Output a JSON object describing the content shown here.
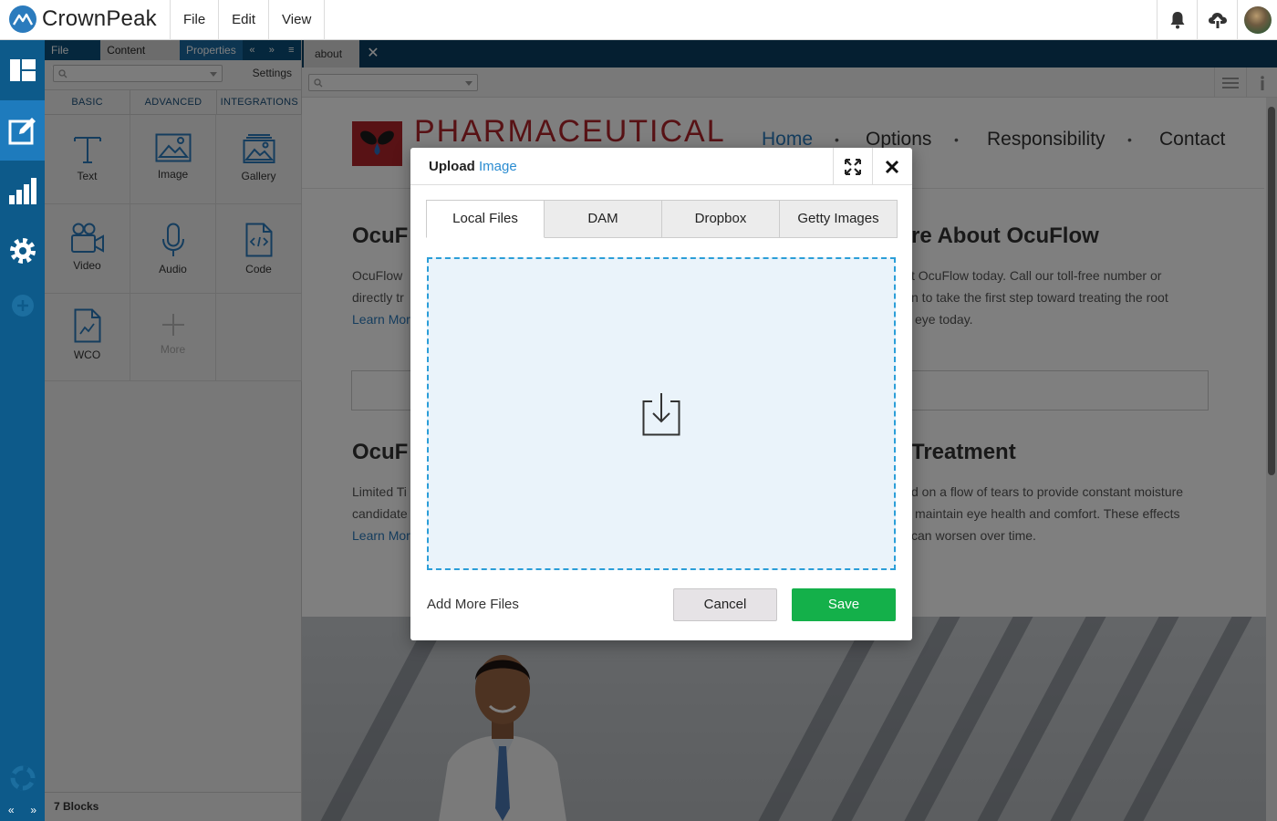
{
  "app": {
    "brand": "CrownPeak",
    "menu": [
      "File",
      "Edit",
      "View"
    ],
    "top_icons": [
      "bell-icon",
      "cloud-upload-icon",
      "user-avatar"
    ]
  },
  "rail": {
    "items": [
      "dashboard-icon",
      "edit-icon",
      "analytics-icon",
      "settings-icon",
      "add-icon",
      "help-icon"
    ],
    "active": "edit-icon",
    "bottom": [
      "«",
      "»"
    ]
  },
  "panel": {
    "tabs": [
      "File View",
      "Content Block",
      "Properties"
    ],
    "active_tab": "Content Block",
    "controls": [
      "«",
      "»",
      "≡"
    ],
    "search_placeholder": "",
    "settings_label": "Settings",
    "categories": [
      "BASIC",
      "ADVANCED",
      "INTEGRATIONS"
    ],
    "blocks": [
      {
        "label": "Text",
        "icon": "text-icon"
      },
      {
        "label": "Image",
        "icon": "image-icon"
      },
      {
        "label": "Gallery",
        "icon": "gallery-icon"
      },
      {
        "label": "Video",
        "icon": "video-icon"
      },
      {
        "label": "Audio",
        "icon": "microphone-icon"
      },
      {
        "label": "Code",
        "icon": "code-file-icon"
      },
      {
        "label": "WCO",
        "icon": "wco-file-icon"
      },
      {
        "label": "More",
        "icon": "plus-icon"
      }
    ],
    "footer": "7 Blocks"
  },
  "document": {
    "tab_label": "about",
    "close_label": "✕"
  },
  "site": {
    "title": "PHARMACEUTICAL",
    "nav": [
      "Home",
      "Options",
      "Responsibility",
      "Contact"
    ],
    "nav_sep": "•",
    "left_col": {
      "heading": "OcuF",
      "text_1": "OcuFlow",
      "text_2": "directly tr",
      "link": "Learn Mor",
      "heading_2": "OcuF",
      "text_3": "Limited Ti",
      "text_4": "candidate",
      "link_2": "Learn Mor"
    },
    "right_col": {
      "heading": "re About OcuFlow",
      "text_1": "t OcuFlow today. Call our toll-free number or",
      "text_2": "n to take the first step toward treating the root",
      "text_3": "eye today.",
      "heading_2": "Treatment",
      "text_4": "d on a flow of tears to provide constant moisture",
      "text_5": "maintain eye health and comfort. These effects",
      "text_6": "can worsen over time."
    }
  },
  "modal": {
    "title_prefix": "Upload",
    "title_accent": "Image",
    "tabs": [
      "Local Files",
      "DAM",
      "Dropbox",
      "Getty Images"
    ],
    "active_tab": "Local Files",
    "add_more": "Add More Files",
    "cancel": "Cancel",
    "save": "Save",
    "colors": {
      "accent": "#2b8cd1",
      "save": "#14b04a",
      "dropzone_border": "#2b9ed8"
    }
  }
}
